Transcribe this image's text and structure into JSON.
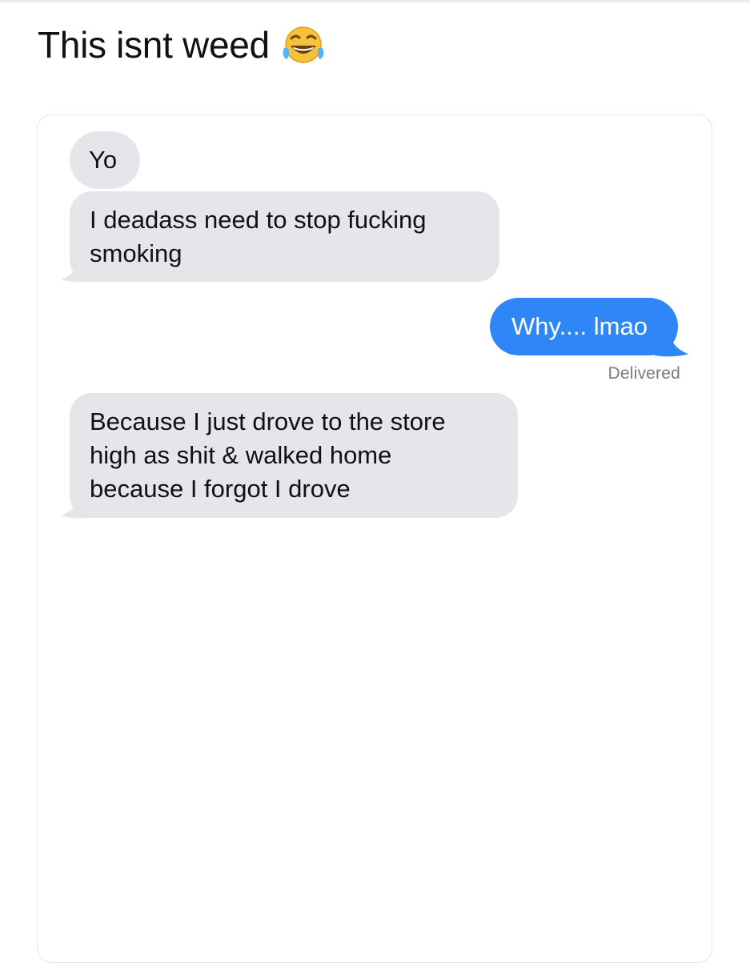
{
  "post": {
    "title": "This isnt weed",
    "title_emoji": "face-with-tears-of-joy-icon"
  },
  "conversation": {
    "messages": [
      {
        "direction": "incoming",
        "lines": [
          "Yo"
        ]
      },
      {
        "direction": "incoming",
        "lines": [
          "I deadass need to stop fucking",
          "smoking"
        ]
      },
      {
        "direction": "outgoing",
        "lines": [
          "Why.... lmao"
        ]
      },
      {
        "direction": "incoming",
        "lines": [
          "Because I just drove to the store",
          "high as shit & walked home",
          "because I forgot I drove"
        ]
      }
    ],
    "delivery_status": "Delivered"
  },
  "colors": {
    "incoming_bubble": "#e5e5ea",
    "outgoing_bubble": "#2f86f6",
    "status_text": "#7a7a7f"
  }
}
